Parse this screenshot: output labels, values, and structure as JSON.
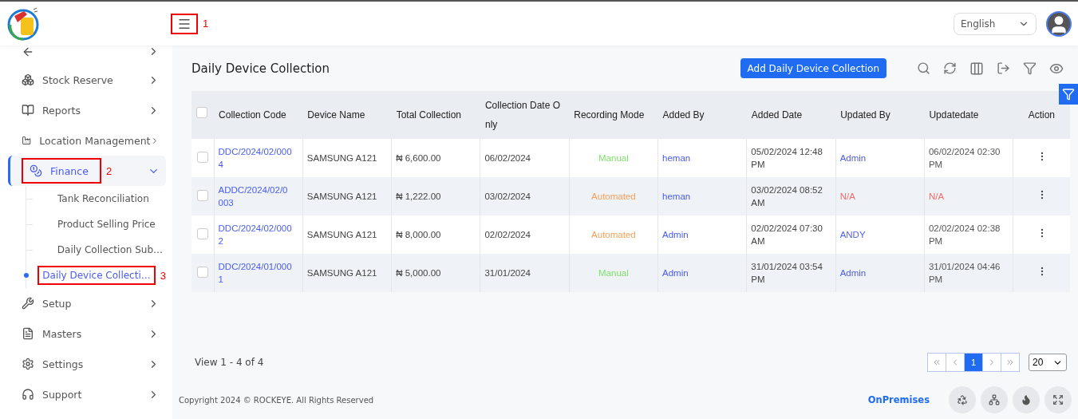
{
  "header": {
    "menu_annotation": "1",
    "language": "English"
  },
  "sidebar": {
    "items": [
      {
        "expanded": false,
        "selected": false
      },
      {
        "label": "Stock Reserve",
        "expanded": false,
        "selected": false
      },
      {
        "label": "Reports",
        "expanded": false,
        "selected": false
      },
      {
        "label": "Location Management",
        "expanded": false,
        "selected": false
      },
      {
        "label": "Finance",
        "expanded": true,
        "selected": true,
        "annotation": "2",
        "children": [
          {
            "label": "Tank Reconciliation",
            "selected": false
          },
          {
            "label": "Product Selling Price",
            "selected": false
          },
          {
            "label": "Daily Collection Sub…",
            "selected": false
          },
          {
            "label": "Daily Device Collecti…",
            "selected": true,
            "annotation": "3"
          }
        ]
      },
      {
        "label": "Setup",
        "expanded": false,
        "selected": false
      },
      {
        "label": "Masters",
        "expanded": false,
        "selected": false
      },
      {
        "label": "Settings",
        "expanded": false,
        "selected": false
      },
      {
        "label": "Support",
        "expanded": false,
        "selected": false
      }
    ]
  },
  "page": {
    "title": "Daily Device Collection",
    "add_button": "Add Daily Device Collection"
  },
  "table": {
    "select_all_checked": false,
    "columns": [
      "Collection Code",
      "Device Name",
      "Total Collection",
      "Collection Date O nly",
      "Recording Mode",
      "Added By",
      "Added Date",
      "Updated By",
      "Updatedate",
      "Action"
    ],
    "rows": [
      {
        "checked": false,
        "code": "DDC/2024/02/000 4",
        "device": "SAMSUNG A121",
        "total": "₦ 6,600.00",
        "date": "06/02/2024",
        "mode": {
          "text": "Manual",
          "color": "#7ee36b"
        },
        "added_by": "heman",
        "added_date": "05/02/2024 12:48 PM",
        "updated_by": {
          "text": "Admin",
          "color": "#4f5ef5"
        },
        "updatedate": {
          "text": "06/02/2024 02:30 PM",
          "color": "#555555"
        }
      },
      {
        "checked": false,
        "code": "ADDC/2024/02/0 003",
        "device": "SAMSUNG A121",
        "total": "₦ 1,222.00",
        "date": "03/02/2024",
        "mode": {
          "text": "Automated",
          "color": "#f5a05a"
        },
        "added_by": "heman",
        "added_date": "03/02/2024 08:52 AM",
        "updated_by": {
          "text": "N/A",
          "color": "#f06b6b"
        },
        "updatedate": {
          "text": "N/A",
          "color": "#f06b6b"
        }
      },
      {
        "checked": false,
        "code": "DDC/2024/02/000 2",
        "device": "SAMSUNG A121",
        "total": "₦ 8,000.00",
        "date": "02/02/2024",
        "mode": {
          "text": "Automated",
          "color": "#f5a05a"
        },
        "added_by": "Admin",
        "added_date": "02/02/2024 07:30 AM",
        "updated_by": {
          "text": "ANDY",
          "color": "#4f5ef5"
        },
        "updatedate": {
          "text": "02/02/2024 02:38 PM",
          "color": "#555555"
        }
      },
      {
        "checked": false,
        "code": "DDC/2024/01/000 1",
        "device": "SAMSUNG A121",
        "total": "₦ 5,000.00",
        "date": "31/01/2024",
        "mode": {
          "text": "Manual",
          "color": "#7ee36b"
        },
        "added_by": "Admin",
        "added_date": "31/01/2024 03:54 PM",
        "updated_by": {
          "text": "Admin",
          "color": "#4f5ef5"
        },
        "updatedate": {
          "text": "31/01/2024 04:46 PM",
          "color": "#555555"
        }
      }
    ]
  },
  "pagination": {
    "summary": "View 1 - 4 of 4",
    "pages": [
      {
        "label": "1",
        "selected": true
      }
    ],
    "page_size": "20"
  },
  "footer": {
    "copyright": "Copyright 2024 © ROCKEYE. All Rights Reserved",
    "mode": "OnPremises"
  }
}
